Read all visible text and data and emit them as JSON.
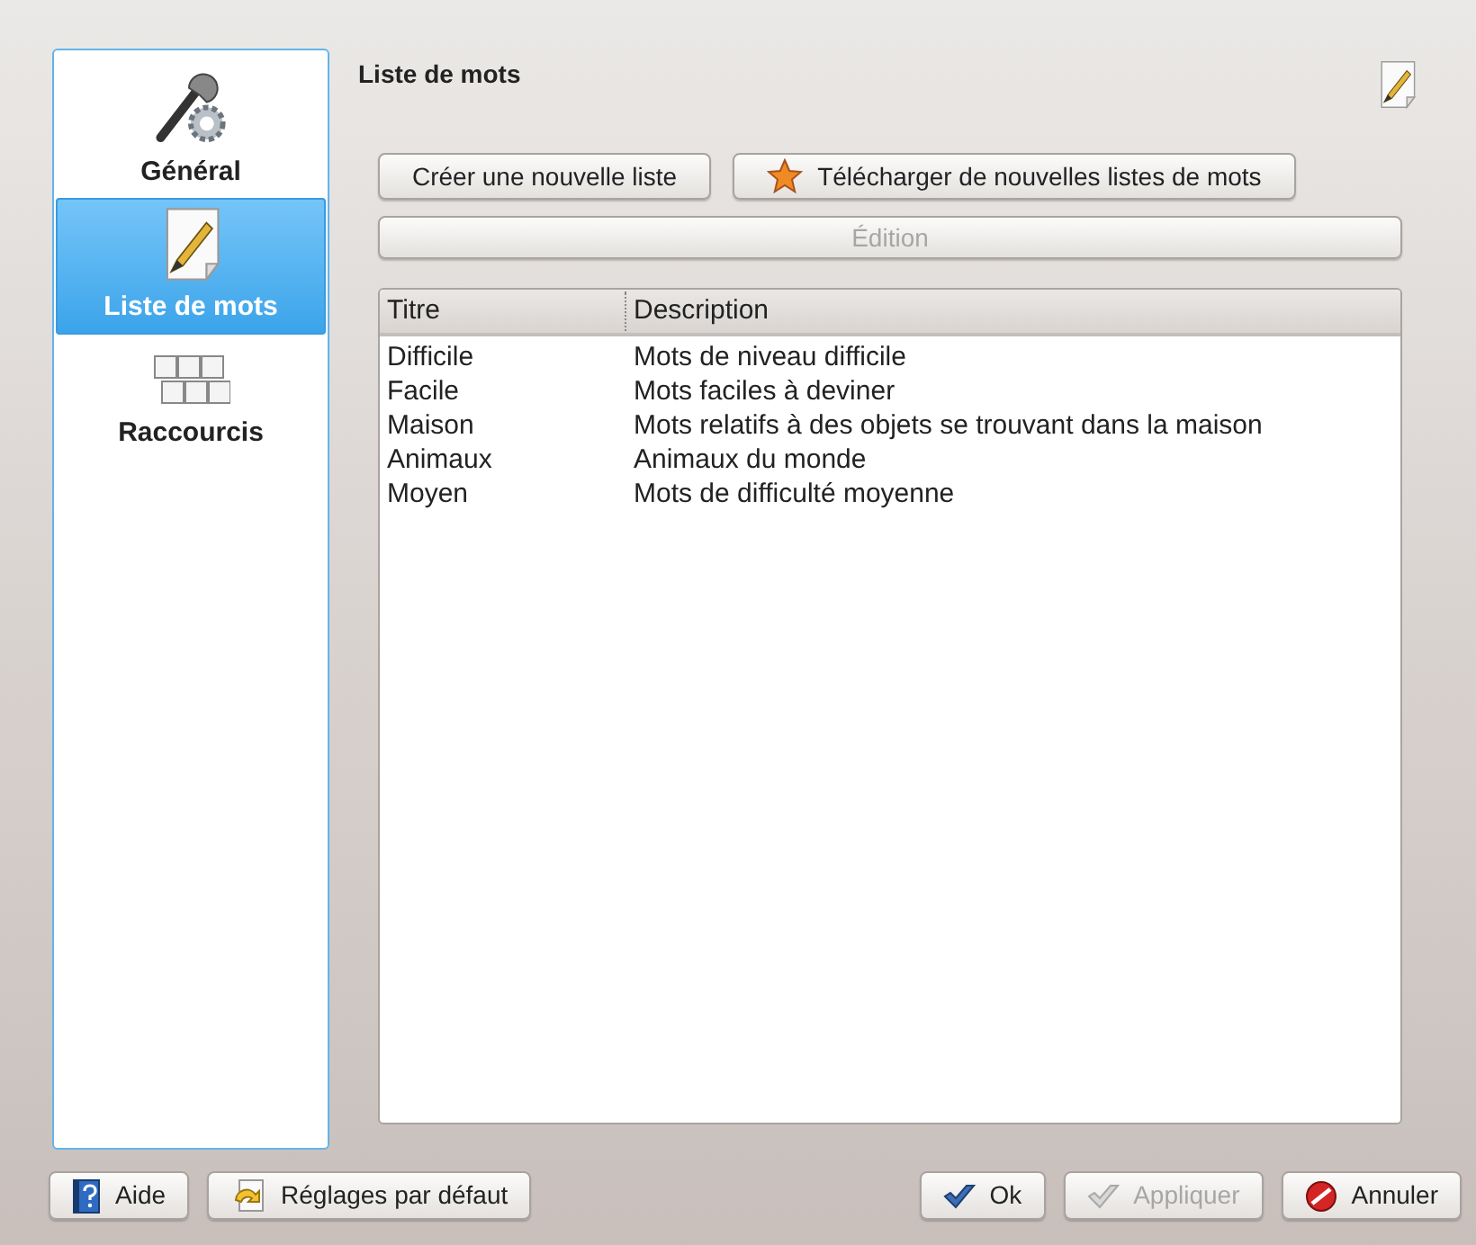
{
  "sidebar": {
    "items": [
      {
        "label": "Général",
        "kind": "general",
        "selected": false
      },
      {
        "label": "Liste de mots",
        "kind": "wordlist",
        "selected": true
      },
      {
        "label": "Raccourcis",
        "kind": "shortcuts",
        "selected": false
      }
    ]
  },
  "page": {
    "title": "Liste de mots",
    "buttons": [
      {
        "label": "Créer une nouvelle liste",
        "kind": "plain"
      },
      {
        "label": "Télécharger de nouvelles listes de mots",
        "kind": "download"
      }
    ],
    "edit_button": {
      "label": "Édition",
      "disabled": true
    },
    "table": {
      "columns": [
        "Titre",
        "Description"
      ],
      "rows": [
        [
          "Difficile",
          "Mots de niveau difficile"
        ],
        [
          "Facile",
          "Mots faciles à deviner"
        ],
        [
          "Maison",
          "Mots relatifs à des objets se trouvant dans la maison"
        ],
        [
          "Animaux",
          "Animaux du monde"
        ],
        [
          "Moyen",
          "Mots de difficulté moyenne"
        ]
      ]
    }
  },
  "footer": {
    "left": [
      {
        "label": "Aide",
        "kind": "help",
        "disabled": false
      },
      {
        "label": "Réglages par défaut",
        "kind": "defaults",
        "disabled": false
      }
    ],
    "right": [
      {
        "label": "Ok",
        "kind": "ok",
        "disabled": false
      },
      {
        "label": "Appliquer",
        "kind": "apply",
        "disabled": true
      },
      {
        "label": "Annuler",
        "kind": "cancel",
        "disabled": false
      }
    ]
  }
}
